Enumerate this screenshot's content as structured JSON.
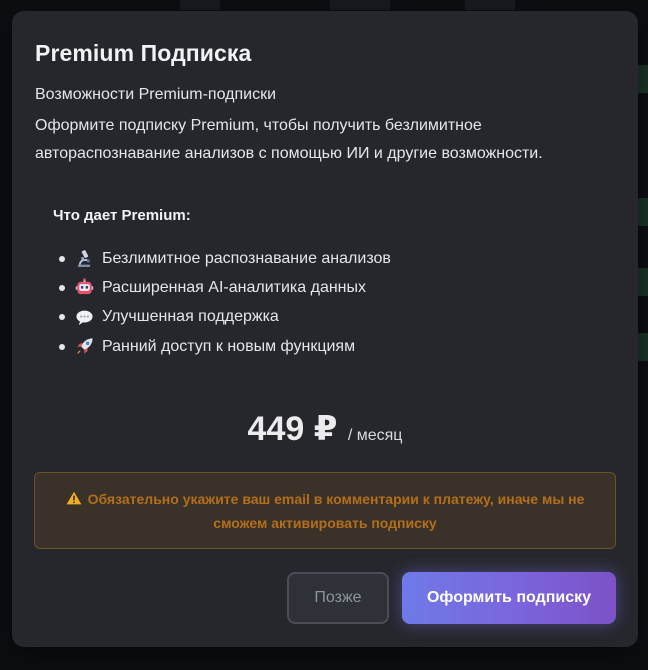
{
  "modal": {
    "title": "Premium Подписка",
    "subtitle": "Возможности Premium-подписки",
    "description": "Оформите подписку Premium, чтобы получить безлимитное автораспознавание анализов с помощью ИИ и другие возможности.",
    "benefits_heading": "Что дает Premium:",
    "benefits": [
      {
        "icon": "microscope-icon",
        "label": "Безлимитное распознавание анализов"
      },
      {
        "icon": "robot-icon",
        "label": "Расширенная AI-аналитика данных"
      },
      {
        "icon": "speech-bubble-icon",
        "label": "Улучшенная поддержка"
      },
      {
        "icon": "rocket-icon",
        "label": "Ранний доступ к новым функциям"
      }
    ],
    "price": {
      "amount": "449 ₽",
      "period": "/ месяц"
    },
    "warning": {
      "icon": "warning-icon",
      "text": "Обязательно укажите ваш email в комментарии к платежу, иначе мы не сможем активировать подписку"
    },
    "buttons": {
      "later_label": "Позже",
      "subscribe_label": "Оформить подписку"
    }
  },
  "colors": {
    "modal_bg": "#26272d",
    "accent_gradient_start": "#6f7ae8",
    "accent_gradient_end": "#7c52c6",
    "warning_text": "#b36f1c",
    "warning_border": "#6b5126"
  }
}
